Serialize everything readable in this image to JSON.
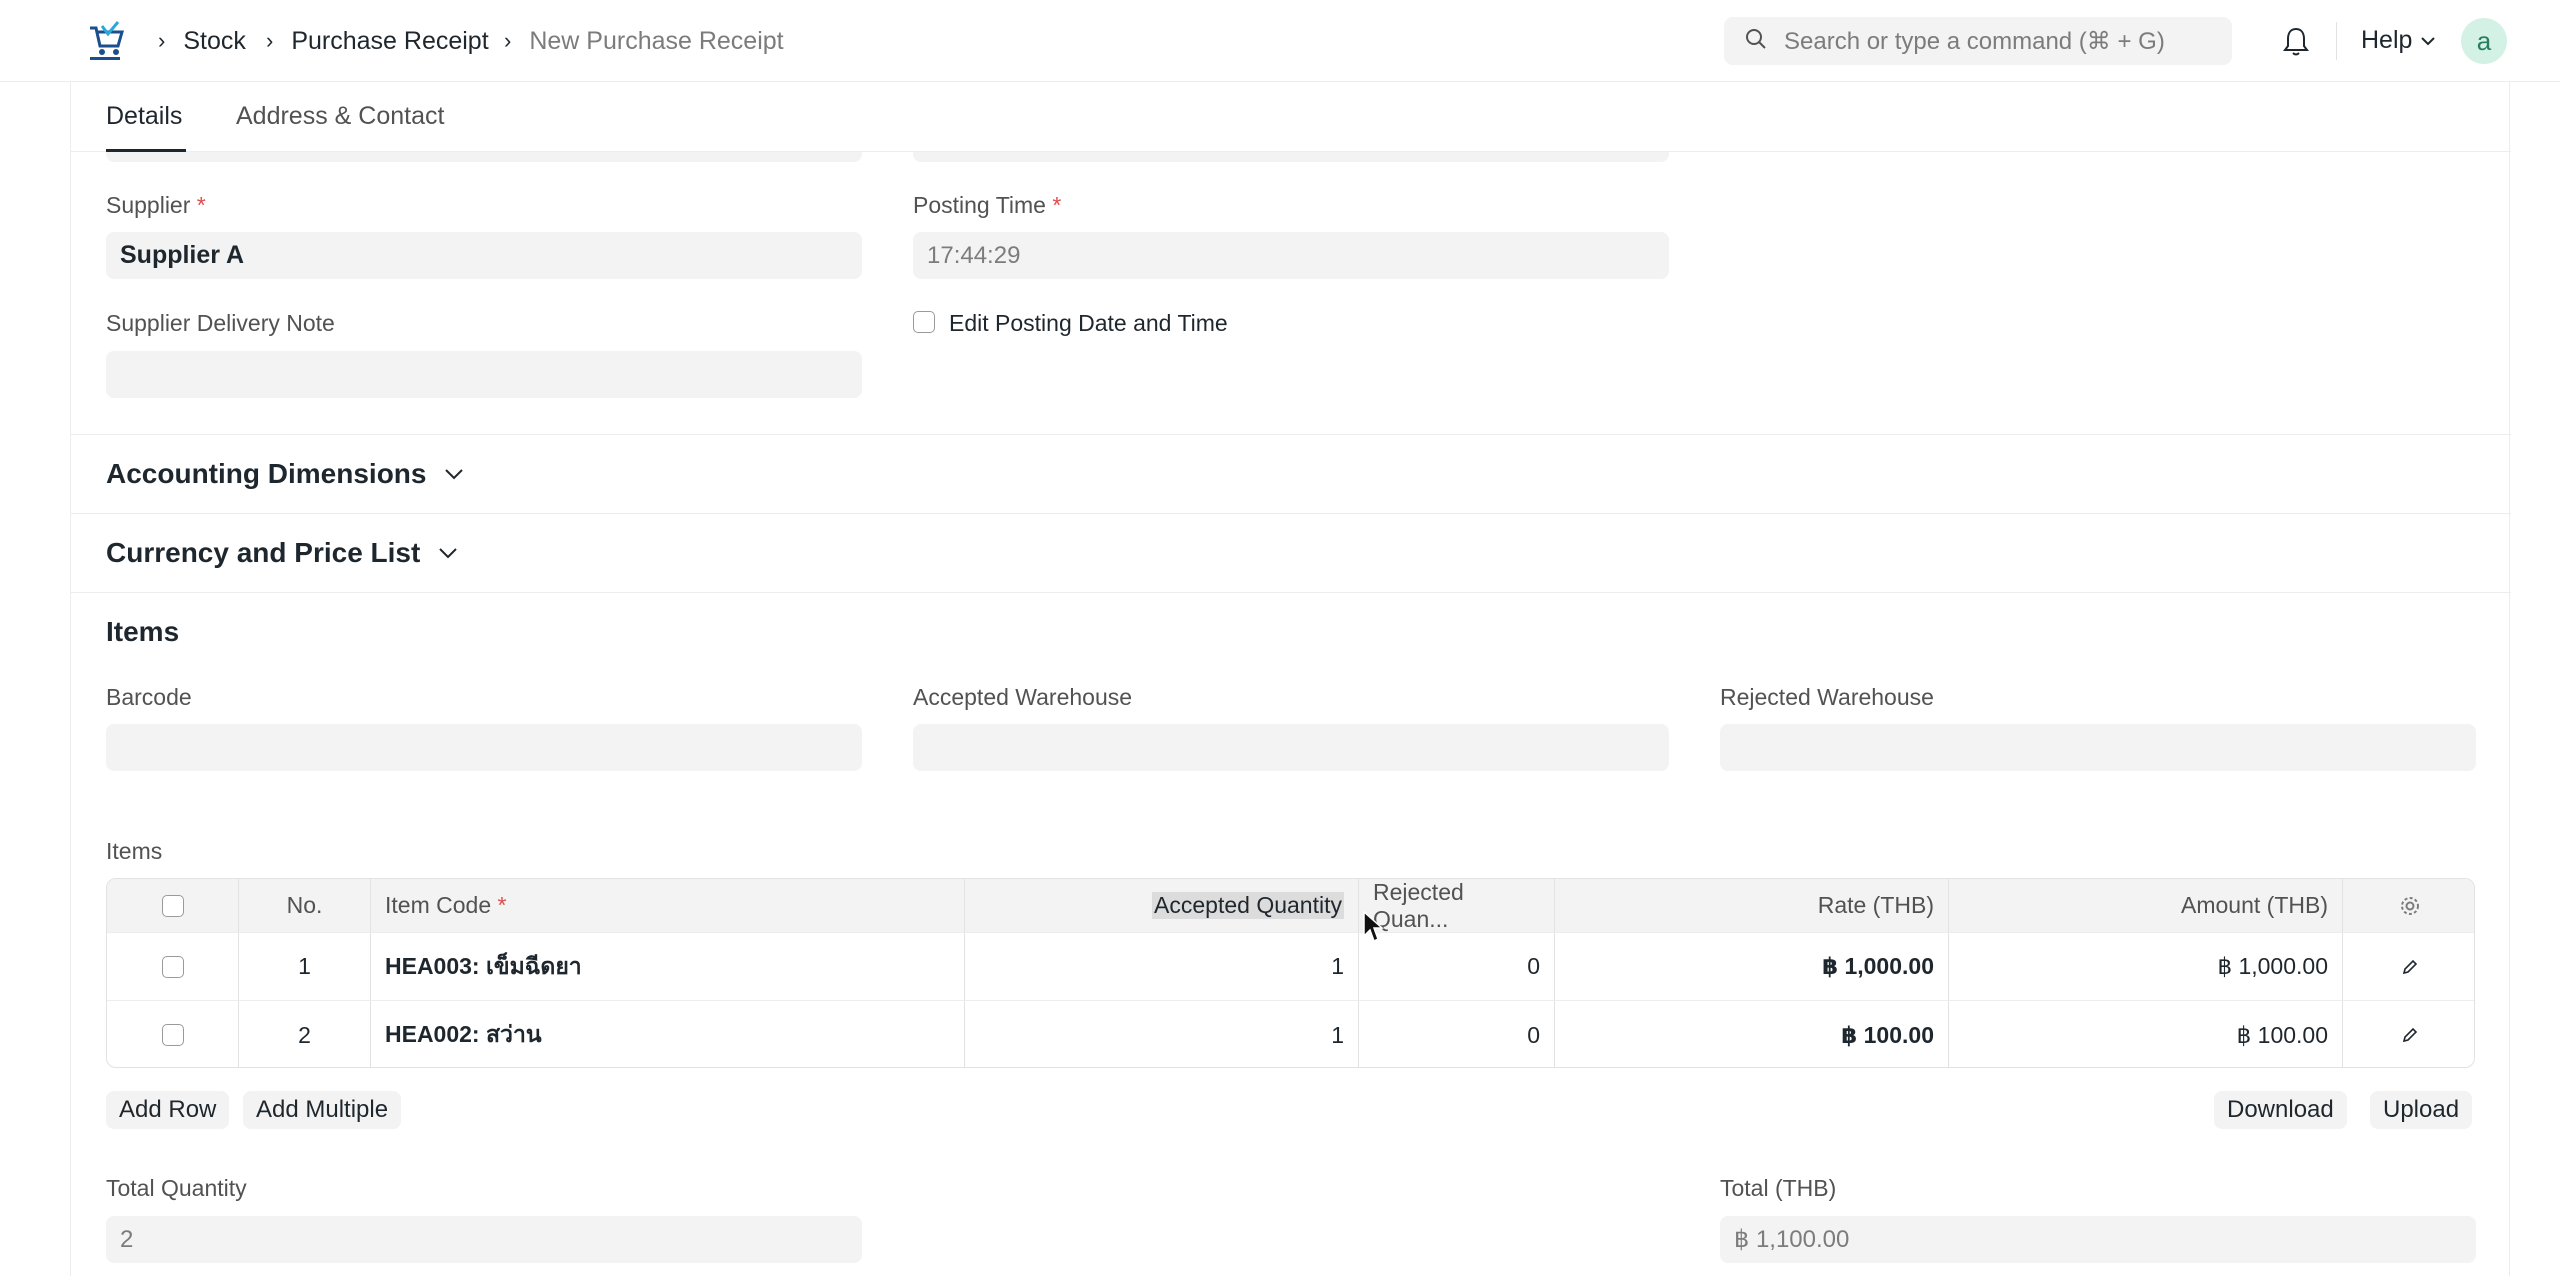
{
  "navbar": {
    "breadcrumbs": [
      "Stock",
      "Purchase Receipt",
      "New Purchase Receipt"
    ],
    "search_placeholder": "Search or type a command (⌘ + G)",
    "help_label": "Help",
    "avatar_letter": "a"
  },
  "tabs": [
    "Details",
    "Address & Contact"
  ],
  "form": {
    "supplier": {
      "label": "Supplier",
      "value": "Supplier A"
    },
    "posting_time": {
      "label": "Posting Time",
      "value": "17:44:29"
    },
    "supplier_delivery_note": {
      "label": "Supplier Delivery Note",
      "value": ""
    },
    "edit_posting": {
      "label": "Edit Posting Date and Time",
      "checked": false
    }
  },
  "sections": {
    "accounting_dimensions": "Accounting Dimensions",
    "currency_price_list": "Currency and Price List",
    "items": "Items"
  },
  "items_section": {
    "barcode_label": "Barcode",
    "accepted_warehouse_label": "Accepted Warehouse",
    "rejected_warehouse_label": "Rejected Warehouse",
    "table_label": "Items"
  },
  "items_table": {
    "columns": [
      "No.",
      "Item Code",
      "Accepted Quantity",
      "Rejected Quan...",
      "Rate (THB)",
      "Amount (THB)"
    ],
    "rows": [
      {
        "no": "1",
        "item_code": "HEA003: เข็มฉีดยา",
        "accepted_qty": "1",
        "rejected_qty": "0",
        "rate": "฿ 1,000.00",
        "amount": "฿ 1,000.00"
      },
      {
        "no": "2",
        "item_code": "HEA002: สว่าน",
        "accepted_qty": "1",
        "rejected_qty": "0",
        "rate": "฿ 100.00",
        "amount": "฿ 100.00"
      }
    ]
  },
  "buttons": {
    "add_row": "Add Row",
    "add_multiple": "Add Multiple",
    "download": "Download",
    "upload": "Upload"
  },
  "totals": {
    "total_quantity": {
      "label": "Total Quantity",
      "value": "2"
    },
    "total_thb": {
      "label": "Total (THB)",
      "value": "฿ 1,100.00"
    }
  },
  "colors": {
    "required": "#e24c4c",
    "avatar_bg": "#d4f1e5",
    "field_bg": "#f3f3f3"
  }
}
